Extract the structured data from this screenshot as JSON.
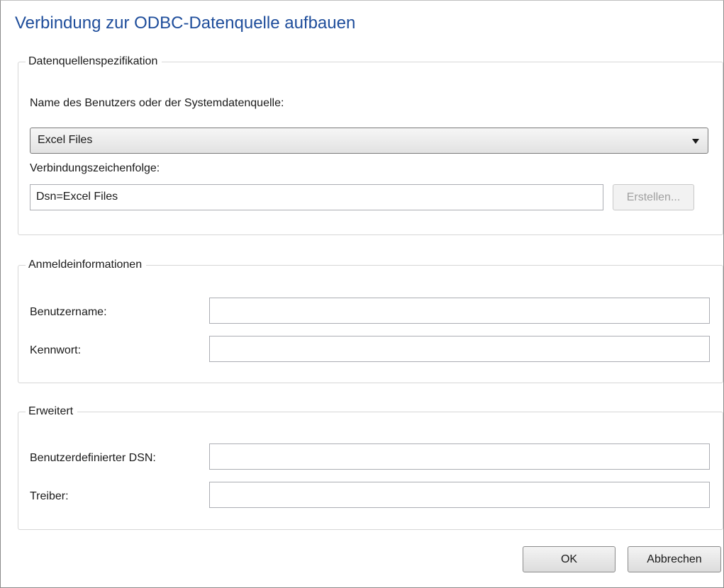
{
  "dialog": {
    "title": "Verbindung zur ODBC-Datenquelle aufbauen"
  },
  "datasource": {
    "legend": "Datenquellenspezifikation",
    "dsn_label": "Name des Benutzers oder der Systemdatenquelle:",
    "dsn_selected": "Excel Files",
    "connstr_label": "Verbindungszeichenfolge:",
    "connstr_value": "Dsn=Excel Files",
    "build_button": "Erstellen..."
  },
  "credentials": {
    "legend": "Anmeldeinformationen",
    "username_label": "Benutzername:",
    "username_value": "",
    "password_label": "Kennwort:",
    "password_value": ""
  },
  "advanced": {
    "legend": "Erweitert",
    "custom_dsn_label": "Benutzerdefinierter DSN:",
    "custom_dsn_value": "",
    "driver_label": "Treiber:",
    "driver_value": ""
  },
  "buttons": {
    "ok": "OK",
    "cancel": "Abbrechen"
  }
}
